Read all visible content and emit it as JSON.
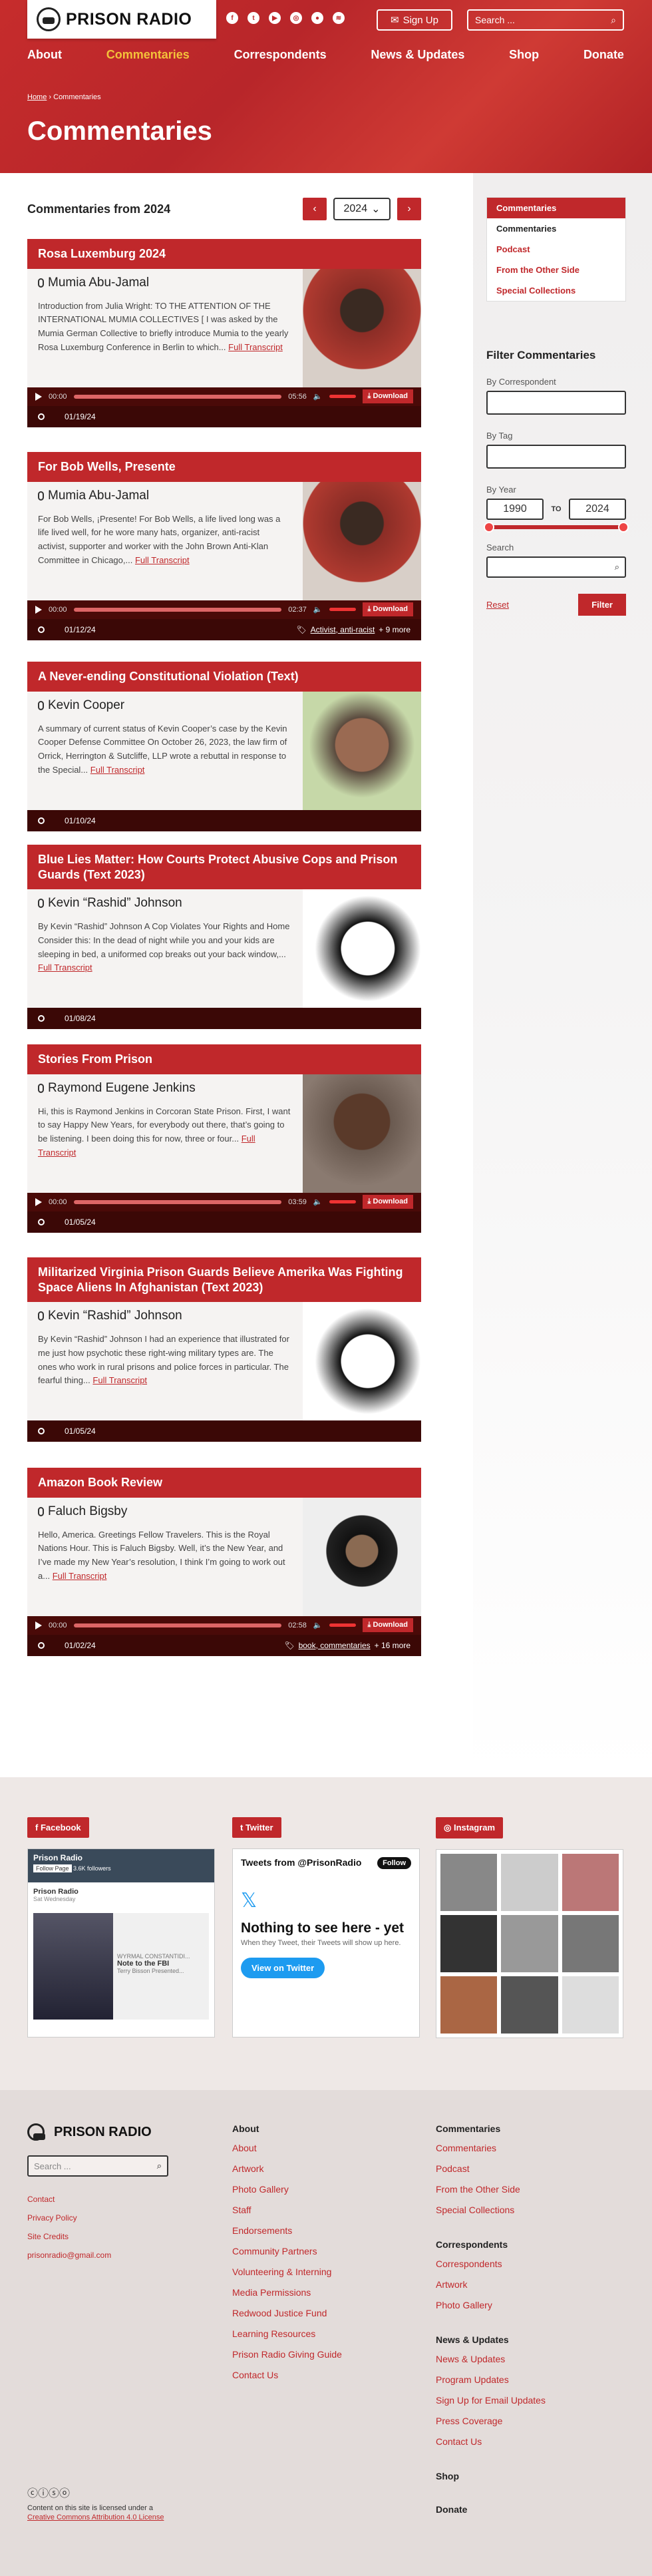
{
  "header": {
    "logo": "PRISON RADIO",
    "signup": "Sign Up",
    "search_placeholder": "Search ...",
    "nav": [
      "About",
      "Commentaries",
      "Correspondents",
      "News & Updates",
      "Shop",
      "Donate"
    ],
    "crumb_home": "Home",
    "crumb_current": "Commentaries",
    "title": "Commentaries"
  },
  "list": {
    "heading": "Commentaries from 2024",
    "year": "2024"
  },
  "cards": [
    {
      "title": "Rosa Luxemburg 2024",
      "author": "Mumia Abu-Jamal",
      "desc": "Introduction from Julia Wright: TO THE ATTENTION OF THE INTERNATIONAL MUMIA COLLECTIVES [ I was asked  by the Mumia German Collective to briefly introduce Mumia to the yearly Rosa Luxemburg Conference in Berlin to which...",
      "date": "01/19/24",
      "start": "00:00",
      "dur": "05:56",
      "tags": "",
      "more": ""
    },
    {
      "title": "For Bob Wells, Presente",
      "author": "Mumia Abu-Jamal",
      "desc": "For Bob Wells, ¡Presente! For Bob Wells, a life lived long was a life lived well, for he wore many hats, organizer, anti-racist activist, supporter and worker with the John Brown Anti-Klan Committee in Chicago,...",
      "date": "01/12/24",
      "start": "00:00",
      "dur": "02:37",
      "tags": "Activist, anti-racist",
      "more": "+ 9 more"
    },
    {
      "title": "A Never-ending Constitutional Violation (Text)",
      "author": "Kevin Cooper",
      "desc": "A summary of current status of Kevin Cooper’s case by the Kevin Cooper Defense Committee On October 26, 2023, the law firm of Orrick, Herrington & Sutcliffe, LLP wrote a rebuttal in response to the Special...",
      "date": "01/10/24",
      "start": "",
      "dur": "",
      "tags": "",
      "more": ""
    },
    {
      "title": "Blue Lies Matter: How Courts Protect Abusive Cops and Prison Guards (Text 2023)",
      "author": "Kevin “Rashid” Johnson",
      "desc": "By Kevin “Rashid” Johnson A Cop Violates Your Rights and Home Consider this: In the dead of night while you and your kids are sleeping in bed, a uniformed cop breaks out your back window,...",
      "date": "01/08/24",
      "start": "",
      "dur": "",
      "tags": "",
      "more": ""
    },
    {
      "title": "Stories From Prison",
      "author": "Raymond Eugene Jenkins",
      "desc": "Hi, this is Raymond Jenkins in Corcoran State Prison. First, I want to say Happy New Years, for everybody out there, that’s going to be listening. I been doing this for now, three or four...",
      "date": "01/05/24",
      "start": "00:00",
      "dur": "03:59",
      "tags": "",
      "more": ""
    },
    {
      "title": "Militarized Virginia Prison Guards Believe Amerika Was Fighting Space Aliens In Afghanistan (Text 2023)",
      "author": "Kevin “Rashid” Johnson",
      "desc": "By Kevin “Rashid” Johnson I had an experience that illustrated for me just how psychotic these right-wing military types are. The ones who work in rural prisons and police forces in particular. The fearful thing...",
      "date": "01/05/24",
      "start": "",
      "dur": "",
      "tags": "",
      "more": ""
    },
    {
      "title": "Amazon Book Review",
      "author": "Faluch Bigsby",
      "desc": "Hello, America. Greetings Fellow Travelers. This is the Royal Nations Hour. This is Faluch Bigsby. Well, it’s the New Year, and I’ve made my New Year’s resolution, I think I’m going to work out a...",
      "date": "01/02/24",
      "start": "00:00",
      "dur": "02:58",
      "tags": "book, commentaries",
      "more": "+ 16 more"
    }
  ],
  "labels": {
    "full": "Full Transcript",
    "download": "Download"
  },
  "sidebar": {
    "links": [
      "Commentaries",
      "Commentaries",
      "Podcast",
      "From the Other Side",
      "Special Collections"
    ],
    "filter_title": "Filter Commentaries",
    "by_corr": "By Correspondent",
    "by_tag": "By Tag",
    "by_year": "By Year",
    "year_from": "1990",
    "to": "TO",
    "year_to": "2024",
    "search": "Search",
    "reset": "Reset",
    "filter": "Filter"
  },
  "social": {
    "facebook": "Facebook",
    "twitter": "Twitter",
    "instagram": "Instagram",
    "fb_page": "Prison Radio",
    "fb_follow": "Follow Page",
    "fb_followers": "3.6K followers",
    "fb_post_name": "Prison Radio",
    "fb_post_time": "Sat Wednesday",
    "fb_link_src": "WYRMAL CONSTANTIDI...",
    "fb_link_title": "Note to the FBI",
    "fb_link_sub": "Terry Bisson Presented...",
    "tw_head": "Tweets from @PrisonRadio",
    "tw_follow": "Follow",
    "tw_none": "Nothing to see here - yet",
    "tw_sub": "When they Tweet, their Tweets will show up here.",
    "tw_view": "View on Twitter"
  },
  "footer": {
    "logo": "PRISON RADIO",
    "search_placeholder": "Search ...",
    "misc": [
      "Contact",
      "Privacy Policy",
      "Site Credits",
      "prisonradio@gmail.com"
    ],
    "about_title": "About",
    "about": [
      "About",
      "Artwork",
      "Photo Gallery",
      "Staff",
      "Endorsements",
      "Community Partners",
      "Volunteering & Interning",
      "Media Permissions",
      "Redwood Justice Fund",
      "Learning Resources",
      "Prison Radio Giving Guide",
      "Contact Us"
    ],
    "comm_title": "Commentaries",
    "comm": [
      "Commentaries",
      "Podcast",
      "From the Other Side",
      "Special Collections"
    ],
    "corr_title": "Correspondents",
    "corr": [
      "Correspondents",
      "Artwork",
      "Photo Gallery"
    ],
    "news_title": "News & Updates",
    "news": [
      "News & Updates",
      "Program Updates",
      "Sign Up for Email Updates",
      "Press Coverage",
      "Contact Us"
    ],
    "shop": "Shop",
    "donate": "Donate",
    "license1": "Content on this site is licensed under a",
    "license2": "Creative Commons Attribution 4.0 License"
  },
  "colors": {
    "brand": "#c0282b",
    "dark": "#3b0806"
  }
}
